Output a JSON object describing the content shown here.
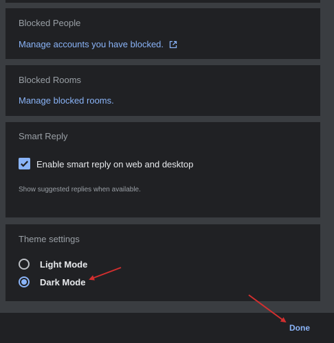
{
  "blocked_people": {
    "title": "Blocked People",
    "link": "Manage accounts you have blocked."
  },
  "blocked_rooms": {
    "title": "Blocked Rooms",
    "link": "Manage blocked rooms."
  },
  "smart_reply": {
    "title": "Smart Reply",
    "checkbox_label": "Enable smart reply on web and desktop",
    "checked": true,
    "hint": "Show suggested replies when available."
  },
  "theme": {
    "title": "Theme settings",
    "options": [
      {
        "label": "Light Mode",
        "selected": false
      },
      {
        "label": "Dark Mode",
        "selected": true
      }
    ]
  },
  "footer": {
    "done_label": "Done"
  },
  "colors": {
    "accent": "#8ab4f8",
    "panel": "#202124",
    "background": "#3a3d41",
    "annotation": "#d32f2f"
  }
}
